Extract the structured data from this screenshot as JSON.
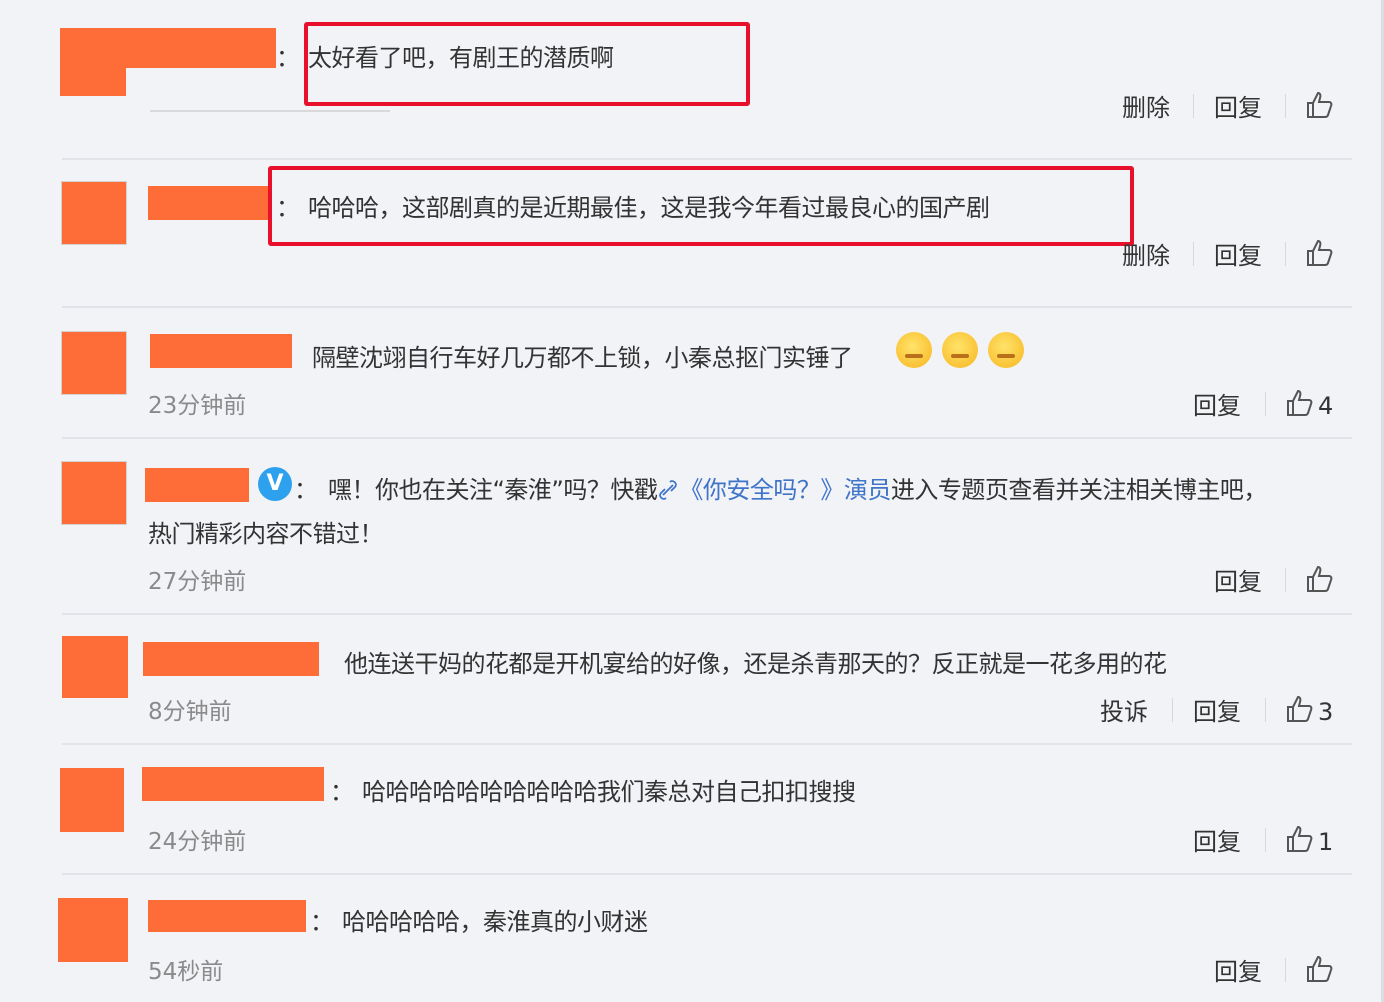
{
  "comments": [
    {
      "text": "太好看了吧，有剧王的潜质啊",
      "actions": [
        "删除",
        "回复"
      ]
    },
    {
      "text": "哈哈哈，这部剧真的是近期最佳，这是我今年看过最良心的国产剧",
      "actions": [
        "删除",
        "回复"
      ]
    },
    {
      "text": "隔壁沈翊自行车好几万都不上锁，小秦总抠门实锤了",
      "time": "23分钟前",
      "actions": [
        "回复"
      ],
      "likes": "4"
    },
    {
      "text_a": "嘿！你也在关注“秦淮”吗？快戳",
      "link": "《你安全吗？》演员",
      "text_b": "进入专题页查看并关注相关博主吧，",
      "text_c": "热门精彩内容不错过！",
      "time": "27分钟前",
      "actions": [
        "回复"
      ]
    },
    {
      "text": "他连送干妈的花都是开机宴给的好像，还是杀青那天的？反正就是一花多用的花",
      "time": "8分钟前",
      "actions": [
        "投诉",
        "回复"
      ],
      "likes": "3"
    },
    {
      "text": "哈哈哈哈哈哈哈哈哈哈我们秦总对自己扣扣搜搜",
      "time": "24分钟前",
      "actions": [
        "回复"
      ],
      "likes": "1"
    },
    {
      "text": "哈哈哈哈哈，秦淮真的小财迷",
      "time": "54秒前",
      "actions": [
        "回复"
      ]
    }
  ],
  "colon": "：",
  "verified_badge": "V",
  "icons": {
    "like": "thumb-up-icon",
    "link": "link-icon",
    "emoji": "smirk-emoji-icon",
    "verified": "verified-badge-icon"
  },
  "colors": {
    "placeholder": "#fe6d38",
    "highlight": "#e8102b",
    "link": "#3f74c8",
    "background": "#f2f3f7"
  }
}
